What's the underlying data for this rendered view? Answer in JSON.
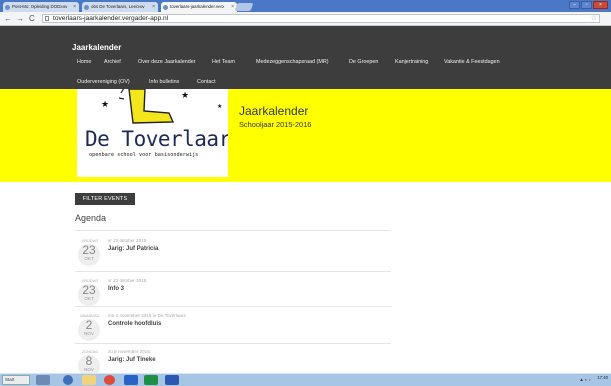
{
  "browser": {
    "tabs": [
      {
        "label": "Post-Mo: Opleiding DOD≥ov"
      },
      {
        "label": "obs De Toverlaars, Leer≥ov"
      },
      {
        "label": "toverlaars-jaarkalender.ver≥"
      }
    ],
    "url": "toverlaars-jaarkalender.vergader-app.nl",
    "icons": {
      "back": "back-arrow-icon",
      "forward": "forward-arrow-icon",
      "reload": "reload-icon"
    }
  },
  "site": {
    "title": "Jaarkalender",
    "menu_row1": [
      "Home",
      "Archief",
      "Over deze Jaarkalender",
      "Het Team",
      "Medezeggenschapsraad (MR)",
      "De Groepen",
      "Kanjertraining",
      "Vakantie & Feestdagen"
    ],
    "menu_row2": [
      "Oudervereniging (OV)",
      "Info bulletins",
      "Contact"
    ]
  },
  "hero": {
    "logo_name": "De Toverlaars",
    "logo_tagline": "openbare school voor basisonderwijs",
    "title": "Jaarkalender",
    "subtitle": "Schooljaar 2015-2016",
    "bg_color": "#ffff00"
  },
  "content": {
    "filter_button": "FILTER EVENTS",
    "agenda_title": "Agenda",
    "events": [
      {
        "dow": "VRIJDAG",
        "day": "23",
        "month": "OKT",
        "when": "vr 23 oktober 2015",
        "title": "Jarig: Juf Patricia"
      },
      {
        "dow": "VRIJDAG",
        "day": "23",
        "month": "OKT",
        "when": "vr 23 oktober 2015",
        "title": "Info 3"
      },
      {
        "dow": "MAANDAG",
        "day": "2",
        "month": "NOV",
        "when": "ma 2 november 2015 in De Toverlaars",
        "title": "Controle hoofdluis"
      },
      {
        "dow": "ZONDAG",
        "day": "8",
        "month": "NOV",
        "when": "zo 8 november 2015",
        "title": "Jarig: Juf Tineke"
      }
    ]
  },
  "taskbar": {
    "start_label": "Start",
    "clock_time": "17:40",
    "icons": [
      "explorer-icon",
      "media-player-icon",
      "chrome-icon",
      "outlook-icon",
      "excel-icon",
      "word-icon"
    ]
  }
}
